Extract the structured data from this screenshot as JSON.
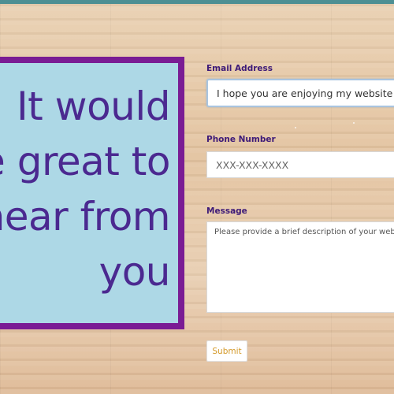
{
  "hero": {
    "lines": [
      "It would",
      "be great to",
      "hear from",
      "you"
    ]
  },
  "form": {
    "email": {
      "label": "Email Address",
      "value": "I hope you are enjoying my website:)"
    },
    "phone": {
      "label": "Phone Number",
      "placeholder": "XXX-XXX-XXXX"
    },
    "message": {
      "label": "Message",
      "placeholder": "Please provide a brief description of your web services needs"
    },
    "submit_label": "Submit"
  },
  "colors": {
    "top_bar": "#4d8f93",
    "quote_bg": "#add8e6",
    "quote_border": "#7a1c94",
    "quote_text": "#4b2990",
    "label_text": "#3d1a78",
    "submit_text": "#d49a2a"
  }
}
